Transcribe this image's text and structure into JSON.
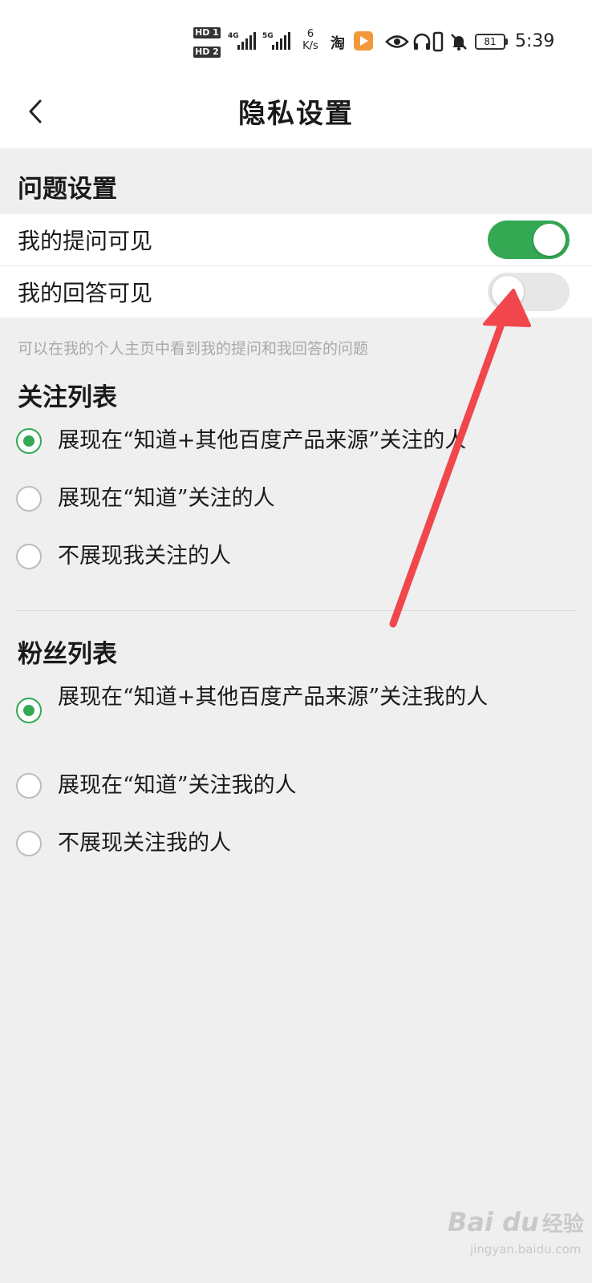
{
  "status_bar": {
    "hd1": "HD 1",
    "hd2": "HD 2",
    "sig1": "4G",
    "sig2": "5G",
    "speed_value": "6",
    "speed_unit": "K/s",
    "taobao_glyph": "淘",
    "battery": "81",
    "time": "5:39",
    "icons": [
      "taobao-icon",
      "video-app-icon",
      "eye-icon",
      "headphones-icon",
      "vibrate-icon",
      "bell-off-icon",
      "battery-icon"
    ]
  },
  "header": {
    "title": "隐私设置",
    "back_icon": "chevron-left-icon"
  },
  "question_settings": {
    "title": "问题设置",
    "toggles": [
      {
        "label": "我的提问可见",
        "state": "on"
      },
      {
        "label": "我的回答可见",
        "state": "off"
      }
    ],
    "hint": "可以在我的个人主页中看到我的提问和我回答的问题"
  },
  "follow_list": {
    "title": "关注列表",
    "options": [
      {
        "label": "展现在“知道+其他百度产品来源”关注的人",
        "checked": true
      },
      {
        "label": "展现在“知道”关注的人",
        "checked": false
      },
      {
        "label": "不展现我关注的人",
        "checked": false
      }
    ]
  },
  "fans_list": {
    "title": "粉丝列表",
    "options": [
      {
        "label": "展现在“知道+其他百度产品来源”关注我的人",
        "checked": true
      },
      {
        "label": "展现在“知道”关注我的人",
        "checked": false
      },
      {
        "label": "不展现关注我的人",
        "checked": false
      }
    ]
  },
  "colors": {
    "accent_green": "#34a853",
    "annotation_arrow": "#f0464c"
  },
  "watermark": {
    "logo": "Bai du",
    "cn": "经验",
    "url": "jingyan.baidu.com"
  }
}
